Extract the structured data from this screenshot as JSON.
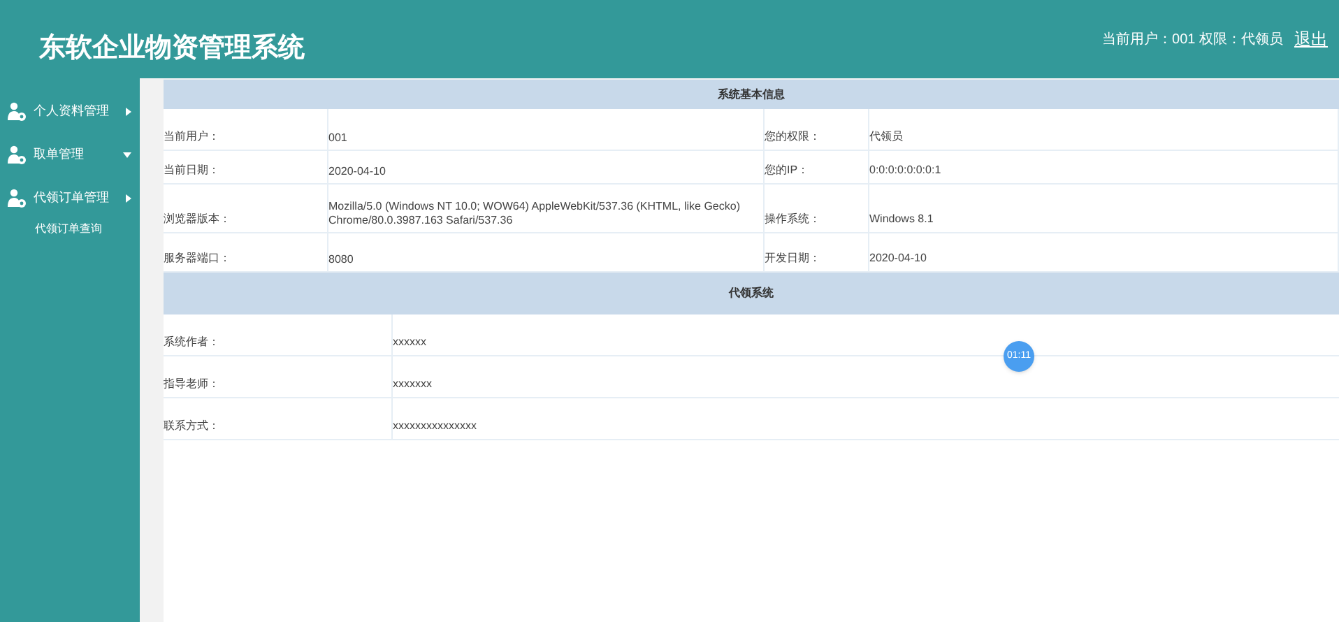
{
  "header": {
    "title": "东软企业物资管理系统",
    "user_info": "当前用户：001 权限：代领员",
    "logout": "退出"
  },
  "sidebar": {
    "items": [
      {
        "label": "个人资料管理",
        "expanded": false
      },
      {
        "label": "取单管理",
        "expanded": true
      },
      {
        "label": "代领订单管理",
        "expanded": false,
        "children": [
          {
            "label": "代领订单查询"
          }
        ]
      }
    ]
  },
  "system_info": {
    "title": "系统基本信息",
    "rows": [
      {
        "label": "当前用户：",
        "value": "001",
        "label_2": "您的权限：",
        "value_2": "代领员"
      },
      {
        "label": "当前日期：",
        "value": "2020-04-10",
        "label_2": "您的IP：",
        "value_2": "0:0:0:0:0:0:0:1"
      },
      {
        "label": "浏览器版本：",
        "value": "Mozilla/5.0 (Windows NT 10.0; WOW64) AppleWebKit/537.36 (KHTML, like Gecko) Chrome/80.0.3987.163 Safari/537.36",
        "label_2": "操作系统：",
        "value_2": "Windows 8.1"
      },
      {
        "label": "服务器端口：",
        "value": "8080",
        "label_2": "开发日期：",
        "value_2": "2020-04-10"
      }
    ]
  },
  "about": {
    "title": "代领系统",
    "rows": [
      {
        "label": "系统作者：",
        "value": "xxxxxx"
      },
      {
        "label": "指导老师：",
        "value": "xxxxxxx"
      },
      {
        "label": "联系方式：",
        "value": "xxxxxxxxxxxxxxx"
      }
    ]
  },
  "timer": "01:11"
}
